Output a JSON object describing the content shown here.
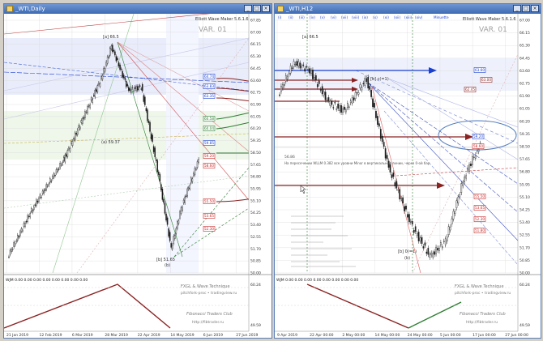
{
  "left": {
    "title": "_WTI,Daily",
    "indicator": "Elliott Wave Maker 5.6.1.6",
    "version": "VAR. 01",
    "price_labels": [
      "67.85",
      "67.00",
      "66.15",
      "65.30",
      "64.45",
      "63.60",
      "62.75",
      "61.90",
      "61.05",
      "60.20",
      "59.35",
      "58.50",
      "57.65",
      "56.80",
      "55.95",
      "55.10",
      "54.25",
      "53.40",
      "52.55",
      "51.70",
      "50.85",
      "50.00"
    ],
    "x_labels": [
      "21 Jan 2019",
      "12 Feb 2019",
      "6 Mar 2019",
      "28 Mar 2019",
      "22 Apr 2019",
      "14 May 2019",
      "6 Jun 2019",
      "27 Jun 2019"
    ],
    "sub_label": "WJM 0.00 0.00 0.00 0.00 0.00 0.00 0.00 0.00",
    "sub_axis": [
      "60.24",
      "49.59"
    ],
    "watermark": [
      "FXGL & Wave Technique",
      "pitchfork-proc • tradingview.ru",
      "Fibonacci Traders Club",
      "http://fibtrader.ru"
    ],
    "wave_labels": [
      "[a] 66.5",
      "(a) 59.37",
      "[b] 51.65",
      "(b)"
    ],
    "marks": [
      "64.74",
      "63.83",
      "63.35",
      "60.58",
      "60.04",
      "59.85",
      "59.20",
      "58.60",
      "55.50",
      "53.65",
      "52.30"
    ]
  },
  "right": {
    "title": "_WTI,H12",
    "indicator": "Elliott Wave Maker 5.6.1.6",
    "version": "VAR. 01",
    "toolbar": [
      "(i)",
      "(ii)",
      "(iii)",
      "(iv)",
      "(v)",
      "(vi)",
      "(vii)",
      "(viii)",
      "(ix)",
      "(x)",
      "(xi)",
      "(xii)",
      "(xiii)",
      "(xiv)",
      "Minuette"
    ],
    "price_labels": [
      "67.00",
      "66.15",
      "65.30",
      "64.45",
      "63.60",
      "62.75",
      "61.90",
      "61.05",
      "60.20",
      "59.35",
      "58.50",
      "57.65",
      "56.80",
      "55.95",
      "55.10",
      "54.25",
      "53.40",
      "52.55",
      "51.70",
      "50.85",
      "50.00"
    ],
    "x_labels": [
      "9 Apr 2019",
      "22 Apr 00:00",
      "2 May 00:00",
      "14 May 00:00",
      "24 May 00:00",
      "5 Jun 00:00",
      "17 Jun 00:00",
      "27 Jun 00:00"
    ],
    "sub_label": "WJM 0.00 0.00 0.00 0.00 0.00 0.00 0.00 0.00",
    "sub_axis": [
      "60.24",
      "49.59"
    ],
    "note": "На пересечении WLLM 0.382 все уровни Minor в вертикальной линии, через 0-ой бар",
    "note_num": "56.86",
    "watermark": [
      "FXGL & Wave Technique",
      "pitchfork-proc • tradingview.ru",
      "Fibonacci Traders Club",
      "http://fibtrader.ru"
    ],
    "wave_labels": [
      "[a] 66.5",
      "[b] c(=1)",
      "[b] 0(=1)",
      "(b)"
    ],
    "marks": [
      "63.60",
      "63.00",
      "62.45",
      "59.20",
      "58.60",
      "55.50",
      "53.65",
      "52.30",
      "51.80"
    ]
  },
  "colors": {
    "title_bg": "#4f7bc0",
    "up": "#2e7d32",
    "down": "#c62828",
    "grid": "#dcdcdc",
    "accent": "#1a3fd1"
  }
}
